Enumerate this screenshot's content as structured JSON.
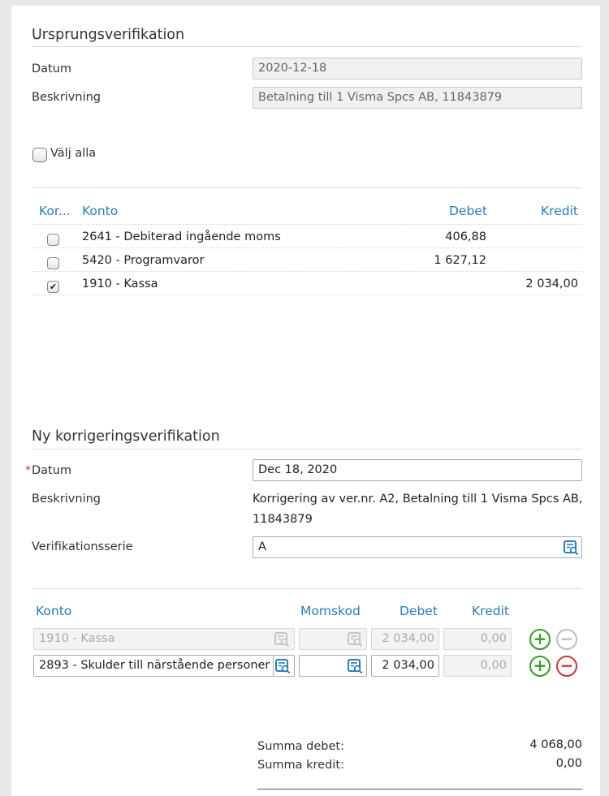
{
  "origin": {
    "title": "Ursprungsverifikation",
    "date_label": "Datum",
    "date_value": "2020-12-18",
    "desc_label": "Beskrivning",
    "desc_value": "Betalning till 1 Visma Spcs AB, 11843879",
    "select_all_label": "Välj alla",
    "columns": {
      "kor": "Kor...",
      "konto": "Konto",
      "debet": "Debet",
      "kredit": "Kredit"
    },
    "rows": [
      {
        "konto": "2641 - Debiterad ingående moms",
        "debet": "406,88",
        "kredit": "",
        "checked": false
      },
      {
        "konto": "5420 - Programvaror",
        "debet": "1 627,12",
        "kredit": "",
        "checked": false
      },
      {
        "konto": "1910 - Kassa",
        "debet": "",
        "kredit": "2 034,00",
        "checked": true
      }
    ]
  },
  "correction": {
    "title": "Ny korrigeringsverifikation",
    "required_mark": "*",
    "date_label": "Datum",
    "date_value": "Dec 18, 2020",
    "desc_label": "Beskrivning",
    "desc_line1": "Korrigering av ver.nr. A2, Betalning till 1 Visma Spcs AB,",
    "desc_line2": "11843879",
    "series_label": "Verifikationsserie",
    "series_value": "A",
    "columns": {
      "konto": "Konto",
      "momskod": "Momskod",
      "debet": "Debet",
      "kredit": "Kredit"
    },
    "rows": [
      {
        "konto": "1910 - Kassa",
        "momskod": "",
        "debet": "2 034,00",
        "kredit": "0,00"
      },
      {
        "konto": "2893 - Skulder till närstående personer",
        "momskod": "",
        "debet": "2 034,00",
        "kredit": "0,00"
      }
    ],
    "summary": {
      "debet_label": "Summa debet:",
      "debet_value": "4 068,00",
      "kredit_label": "Summa kredit:",
      "kredit_value": "0,00"
    }
  },
  "icons": {
    "lookup": "lookup-icon",
    "plus": "+",
    "minus": "−",
    "check": "✔"
  },
  "colors": {
    "accent_blue": "#2a7db5",
    "add_green": "#3a9a2a",
    "remove_red": "#c43a3a"
  }
}
